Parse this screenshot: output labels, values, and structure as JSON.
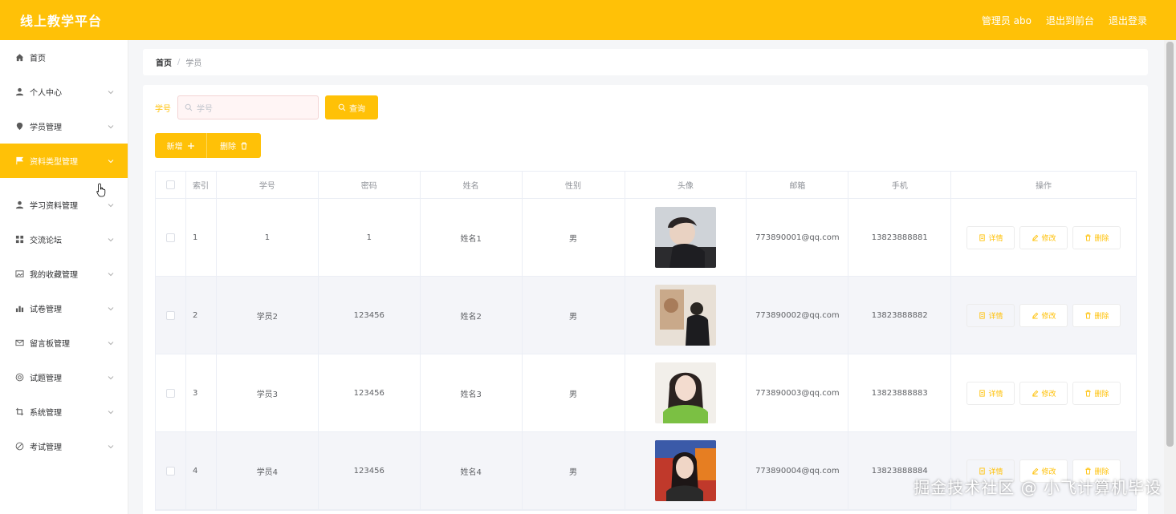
{
  "app": {
    "title": "线上教学平台"
  },
  "topnav": {
    "admin": "管理员 abo",
    "front": "退出到前台",
    "logout": "退出登录"
  },
  "sidebar": {
    "items": [
      {
        "label": "首页",
        "icon": "home-icon"
      },
      {
        "label": "个人中心",
        "icon": "user-icon"
      },
      {
        "label": "学员管理",
        "icon": "location-icon"
      },
      {
        "label": "资料类型管理",
        "icon": "flag-icon",
        "active": true
      },
      {
        "label": "学习资料管理",
        "icon": "user-icon"
      },
      {
        "label": "交流论坛",
        "icon": "grid-icon"
      },
      {
        "label": "我的收藏管理",
        "icon": "picture-icon"
      },
      {
        "label": "试卷管理",
        "icon": "chart-icon"
      },
      {
        "label": "留言板管理",
        "icon": "mail-icon"
      },
      {
        "label": "试题管理",
        "icon": "globe-icon"
      },
      {
        "label": "系统管理",
        "icon": "crop-icon"
      },
      {
        "label": "考试管理",
        "icon": "no-icon"
      }
    ]
  },
  "breadcrumb": {
    "home": "首页",
    "sep": "/",
    "current": "学员"
  },
  "search": {
    "label": "学号",
    "placeholder": "学号",
    "button": "查询"
  },
  "actions": {
    "add": "新增",
    "delete": "删除"
  },
  "table": {
    "headers": [
      "索引",
      "学号",
      "密码",
      "姓名",
      "性别",
      "头像",
      "邮箱",
      "手机",
      "操作"
    ],
    "rows": [
      {
        "index": "1",
        "student_id": "1",
        "password": "1",
        "name": "姓名1",
        "gender": "男",
        "email": "773890001@qq.com",
        "phone": "13823888881"
      },
      {
        "index": "2",
        "student_id": "学员2",
        "password": "123456",
        "name": "姓名2",
        "gender": "男",
        "email": "773890002@qq.com",
        "phone": "13823888882"
      },
      {
        "index": "3",
        "student_id": "学员3",
        "password": "123456",
        "name": "姓名3",
        "gender": "男",
        "email": "773890003@qq.com",
        "phone": "13823888883"
      },
      {
        "index": "4",
        "student_id": "学员4",
        "password": "123456",
        "name": "姓名4",
        "gender": "男",
        "email": "773890004@qq.com",
        "phone": "13823888884"
      }
    ],
    "op_labels": {
      "detail": "详情",
      "edit": "修改",
      "delete": "删除"
    }
  },
  "watermark": "掘金技术社区 @ 小飞计算机毕设",
  "colors": {
    "accent": "#ffc107",
    "stripe": "#f4f5f9"
  }
}
